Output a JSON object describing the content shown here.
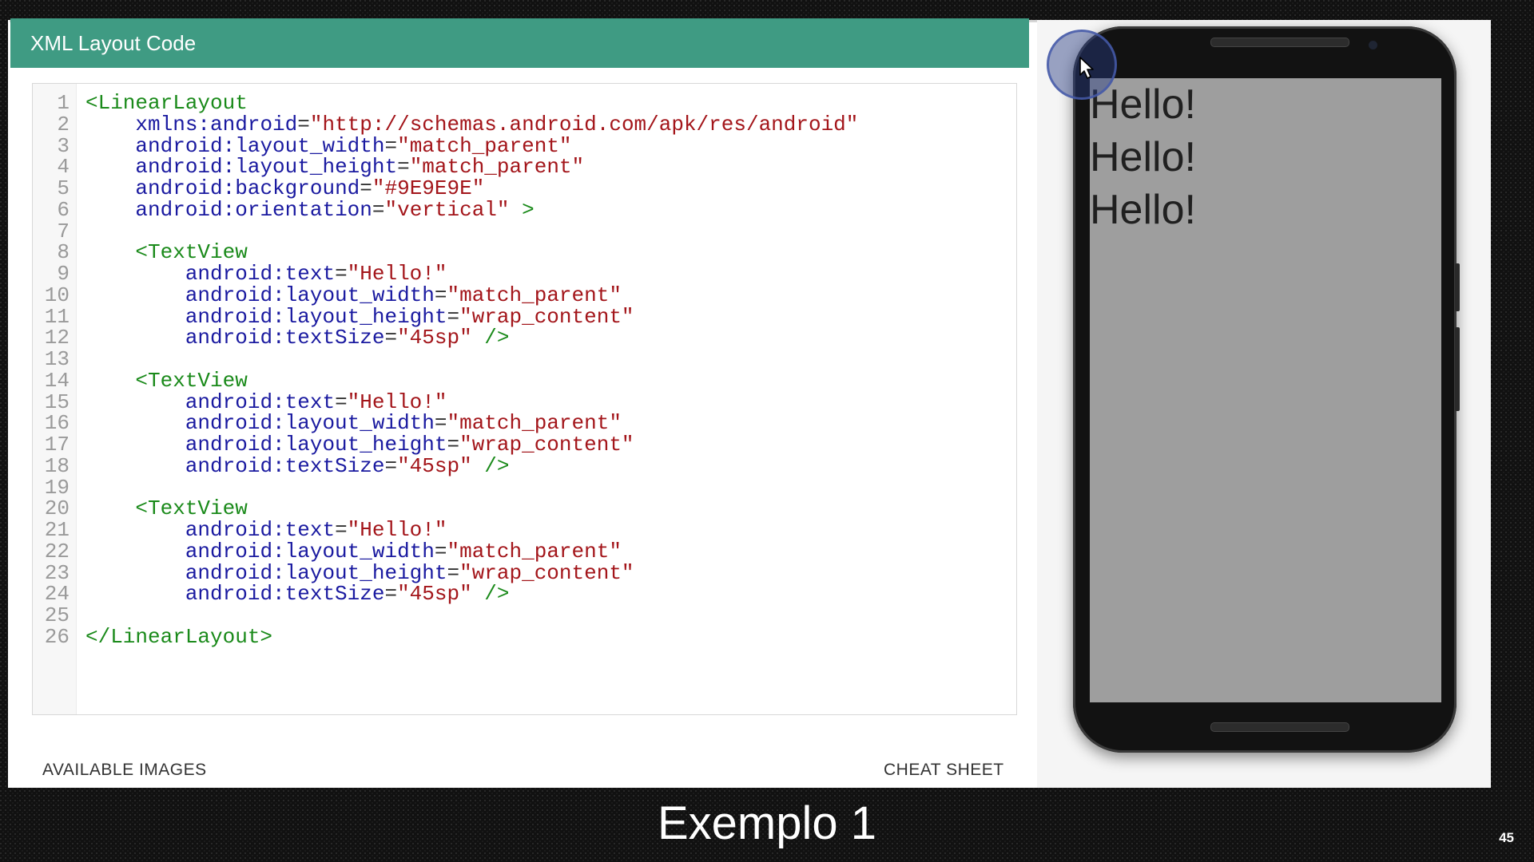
{
  "panel": {
    "title": "XML Layout Code"
  },
  "code": {
    "lines": [
      {
        "n": "1",
        "indent": "",
        "parts": [
          [
            "tag",
            "<LinearLayout"
          ]
        ]
      },
      {
        "n": "2",
        "indent": "    ",
        "parts": [
          [
            "attr",
            "xmlns:android"
          ],
          [
            "punc",
            "="
          ],
          [
            "str",
            "\"http://schemas.android.com/apk/res/android\""
          ]
        ]
      },
      {
        "n": "3",
        "indent": "    ",
        "parts": [
          [
            "attr",
            "android:layout_width"
          ],
          [
            "punc",
            "="
          ],
          [
            "str",
            "\"match_parent\""
          ]
        ]
      },
      {
        "n": "4",
        "indent": "    ",
        "parts": [
          [
            "attr",
            "android:layout_height"
          ],
          [
            "punc",
            "="
          ],
          [
            "str",
            "\"match_parent\""
          ]
        ]
      },
      {
        "n": "5",
        "indent": "    ",
        "parts": [
          [
            "attr",
            "android:background"
          ],
          [
            "punc",
            "="
          ],
          [
            "str",
            "\"#9E9E9E\""
          ]
        ]
      },
      {
        "n": "6",
        "indent": "    ",
        "parts": [
          [
            "attr",
            "android:orientation"
          ],
          [
            "punc",
            "="
          ],
          [
            "str",
            "\"vertical\""
          ],
          [
            "tag",
            " >"
          ]
        ]
      },
      {
        "n": "7",
        "indent": "",
        "parts": []
      },
      {
        "n": "8",
        "indent": "    ",
        "parts": [
          [
            "tag",
            "<TextView"
          ]
        ]
      },
      {
        "n": "9",
        "indent": "        ",
        "parts": [
          [
            "attr",
            "android:text"
          ],
          [
            "punc",
            "="
          ],
          [
            "str",
            "\"Hello!\""
          ]
        ]
      },
      {
        "n": "10",
        "indent": "        ",
        "parts": [
          [
            "attr",
            "android:layout_width"
          ],
          [
            "punc",
            "="
          ],
          [
            "str",
            "\"match_parent\""
          ]
        ]
      },
      {
        "n": "11",
        "indent": "        ",
        "parts": [
          [
            "attr",
            "android:layout_height"
          ],
          [
            "punc",
            "="
          ],
          [
            "str",
            "\"wrap_content\""
          ]
        ]
      },
      {
        "n": "12",
        "indent": "        ",
        "parts": [
          [
            "attr",
            "android:textSize"
          ],
          [
            "punc",
            "="
          ],
          [
            "str",
            "\"45sp\""
          ],
          [
            "tag",
            " />"
          ]
        ]
      },
      {
        "n": "13",
        "indent": "",
        "parts": []
      },
      {
        "n": "14",
        "indent": "    ",
        "parts": [
          [
            "tag",
            "<TextView"
          ]
        ]
      },
      {
        "n": "15",
        "indent": "        ",
        "parts": [
          [
            "attr",
            "android:text"
          ],
          [
            "punc",
            "="
          ],
          [
            "str",
            "\"Hello!\""
          ]
        ]
      },
      {
        "n": "16",
        "indent": "        ",
        "parts": [
          [
            "attr",
            "android:layout_width"
          ],
          [
            "punc",
            "="
          ],
          [
            "str",
            "\"match_parent\""
          ]
        ]
      },
      {
        "n": "17",
        "indent": "        ",
        "parts": [
          [
            "attr",
            "android:layout_height"
          ],
          [
            "punc",
            "="
          ],
          [
            "str",
            "\"wrap_content\""
          ]
        ]
      },
      {
        "n": "18",
        "indent": "        ",
        "parts": [
          [
            "attr",
            "android:textSize"
          ],
          [
            "punc",
            "="
          ],
          [
            "str",
            "\"45sp\""
          ],
          [
            "tag",
            " />"
          ]
        ]
      },
      {
        "n": "19",
        "indent": "",
        "parts": []
      },
      {
        "n": "20",
        "indent": "    ",
        "parts": [
          [
            "tag",
            "<TextView"
          ]
        ]
      },
      {
        "n": "21",
        "indent": "        ",
        "parts": [
          [
            "attr",
            "android:text"
          ],
          [
            "punc",
            "="
          ],
          [
            "str",
            "\"Hello!\""
          ]
        ]
      },
      {
        "n": "22",
        "indent": "        ",
        "parts": [
          [
            "attr",
            "android:layout_width"
          ],
          [
            "punc",
            "="
          ],
          [
            "str",
            "\"match_parent\""
          ]
        ]
      },
      {
        "n": "23",
        "indent": "        ",
        "parts": [
          [
            "attr",
            "android:layout_height"
          ],
          [
            "punc",
            "="
          ],
          [
            "str",
            "\"wrap_content\""
          ]
        ]
      },
      {
        "n": "24",
        "indent": "        ",
        "parts": [
          [
            "attr",
            "android:textSize"
          ],
          [
            "punc",
            "="
          ],
          [
            "str",
            "\"45sp\""
          ],
          [
            "tag",
            " />"
          ]
        ]
      },
      {
        "n": "25",
        "indent": "",
        "parts": []
      },
      {
        "n": "26",
        "indent": "",
        "parts": [
          [
            "tag",
            "</LinearLayout>"
          ]
        ]
      }
    ]
  },
  "footer": {
    "left_link": "AVAILABLE IMAGES",
    "right_link": "CHEAT SHEET"
  },
  "preview": {
    "screen_background": "#9E9E9E",
    "texts": [
      "Hello!",
      "Hello!",
      "Hello!"
    ]
  },
  "subtitle": "Exemplo 1",
  "page_number": "45",
  "colors": {
    "header": "#3f9b83",
    "tag": "#1a8a1a",
    "attr": "#1a1aa0",
    "string": "#a3151a"
  }
}
